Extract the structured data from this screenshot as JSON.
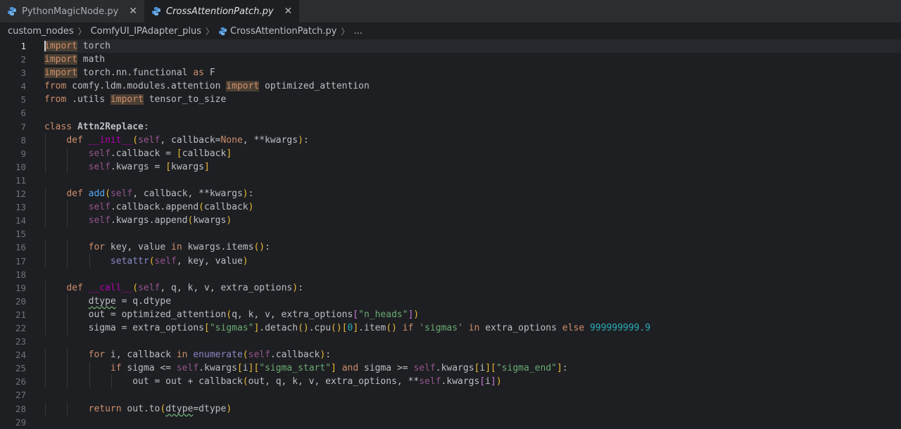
{
  "tabs": [
    {
      "label": "PythonMagicNode.py",
      "active": false
    },
    {
      "label": "CrossAttentionPatch.py",
      "active": true
    }
  ],
  "breadcrumb": {
    "items": [
      "custom_nodes",
      "ComfyUI_IPAdapter_plus",
      "CrossAttentionPatch.py",
      "..."
    ]
  },
  "editor": {
    "current_line": 1,
    "line_numbers": [
      "1",
      "2",
      "3",
      "4",
      "5",
      "6",
      "7",
      "8",
      "9",
      "10",
      "11",
      "12",
      "13",
      "14",
      "15",
      "16",
      "17",
      "18",
      "19",
      "20",
      "21",
      "22",
      "23",
      "24",
      "25",
      "26",
      "27",
      "28",
      "29"
    ],
    "lines": [
      "import torch",
      "import math",
      "import torch.nn.functional as F",
      "from comfy.ldm.modules.attention import optimized_attention",
      "from .utils import tensor_to_size",
      "",
      "class Attn2Replace:",
      "    def __init__(self, callback=None, **kwargs):",
      "        self.callback = [callback]",
      "        self.kwargs = [kwargs]",
      "",
      "    def add(self, callback, **kwargs):",
      "        self.callback.append(callback)",
      "        self.kwargs.append(kwargs)",
      "",
      "        for key, value in kwargs.items():",
      "            setattr(self, key, value)",
      "",
      "    def __call__(self, q, k, v, extra_options):",
      "        dtype = q.dtype",
      "        out = optimized_attention(q, k, v, extra_options[\"n_heads\"])",
      "        sigma = extra_options[\"sigmas\"].detach().cpu()[0].item() if 'sigmas' in extra_options else 999999999.9",
      "",
      "        for i, callback in enumerate(self.callback):",
      "            if sigma <= self.kwargs[i][\"sigma_start\"] and sigma >= self.kwargs[i][\"sigma_end\"]:",
      "                out = out + callback(out, q, k, v, extra_options, **self.kwargs[i])",
      "",
      "        return out.to(dtype=dtype)",
      ""
    ]
  }
}
